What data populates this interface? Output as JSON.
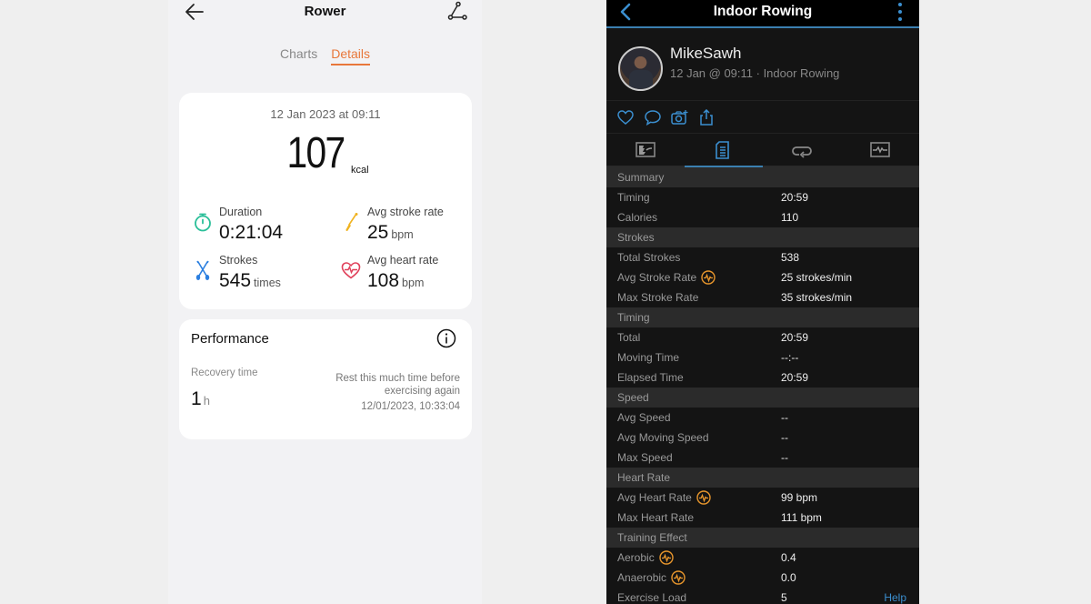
{
  "left_app": {
    "title": "Rower",
    "tabs": [
      {
        "label": "Charts",
        "active": false
      },
      {
        "label": "Details",
        "active": true
      }
    ],
    "accent_color": "#e8773a",
    "summary": {
      "date": "12 Jan 2023 at 09:11",
      "calories": "107",
      "calories_unit": "kcal",
      "stats": [
        {
          "label": "Duration",
          "value": "0:21:04",
          "unit": "",
          "icon": "stopwatch-icon",
          "color": "#2bbf99"
        },
        {
          "label": "Avg stroke rate",
          "value": "25",
          "unit": "bpm",
          "icon": "oar-icon",
          "color": "#f0b320"
        },
        {
          "label": "Strokes",
          "value": "545",
          "unit": "times",
          "icon": "crossed-oars-icon",
          "color": "#2b7fe0"
        },
        {
          "label": "Avg heart rate",
          "value": "108",
          "unit": "bpm",
          "icon": "heart-rate-icon",
          "color": "#e0405a"
        }
      ]
    },
    "performance": {
      "title": "Performance",
      "recovery_label": "Recovery time",
      "recovery_value": "1",
      "recovery_unit": "h",
      "note": "Rest this much time before exercising again",
      "timestamp": "12/01/2023, 10:33:04"
    }
  },
  "right_app": {
    "title": "Indoor Rowing",
    "accent_color": "#3b8fd0",
    "user": {
      "name": "MikeSawh",
      "subtitle": "12 Jan @ 09:11 · Indoor Rowing"
    },
    "actions": [
      "like",
      "comment",
      "add-photo",
      "share"
    ],
    "tabs": [
      {
        "icon": "overview-icon",
        "active": false
      },
      {
        "icon": "details-icon",
        "active": true
      },
      {
        "icon": "laps-icon",
        "active": false
      },
      {
        "icon": "charts-icon",
        "active": false
      }
    ],
    "sections": [
      {
        "title": "Summary",
        "rows": [
          {
            "label": "Timing",
            "value": "20:59"
          },
          {
            "label": "Calories",
            "value": "110"
          }
        ]
      },
      {
        "title": "Strokes",
        "rows": [
          {
            "label": "Total Strokes",
            "value": "538"
          },
          {
            "label": "Avg Stroke Rate",
            "value": "25 strokes/min",
            "badge": true
          },
          {
            "label": "Max Stroke Rate",
            "value": "35 strokes/min"
          }
        ]
      },
      {
        "title": "Timing",
        "rows": [
          {
            "label": "Total",
            "value": "20:59"
          },
          {
            "label": "Moving Time",
            "value": "--:--"
          },
          {
            "label": "Elapsed Time",
            "value": "20:59"
          }
        ]
      },
      {
        "title": "Speed",
        "rows": [
          {
            "label": "Avg Speed",
            "value": "--"
          },
          {
            "label": "Avg Moving Speed",
            "value": "--"
          },
          {
            "label": "Max Speed",
            "value": "--"
          }
        ]
      },
      {
        "title": "Heart Rate",
        "rows": [
          {
            "label": "Avg Heart Rate",
            "value": "99 bpm",
            "badge": true
          },
          {
            "label": "Max Heart Rate",
            "value": "111 bpm"
          }
        ]
      },
      {
        "title": "Training Effect",
        "rows": [
          {
            "label": "Aerobic",
            "value": "0.4",
            "badge": true
          },
          {
            "label": "Anaerobic",
            "value": "0.0",
            "badge": true
          },
          {
            "label": "Exercise Load",
            "value": "5",
            "help": "Help"
          }
        ]
      }
    ]
  }
}
